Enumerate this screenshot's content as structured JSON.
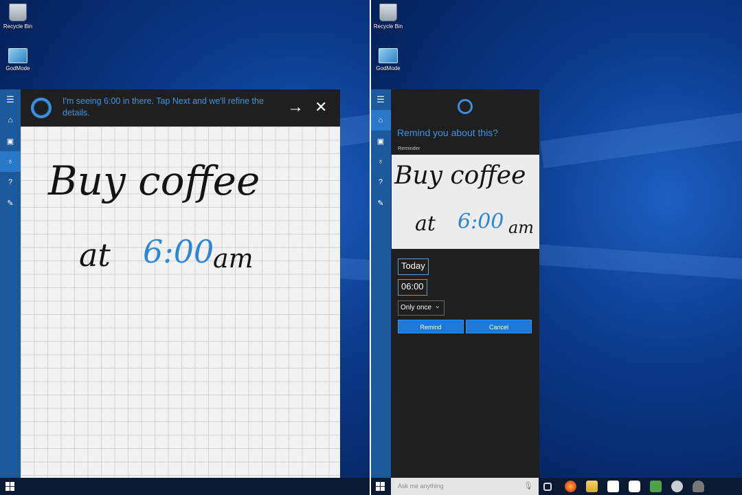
{
  "desktop": {
    "icons": [
      {
        "label": "Recycle Bin",
        "icon": "recycle-bin-icon"
      },
      {
        "label": "GodMode",
        "icon": "godmode-folder-icon"
      }
    ]
  },
  "cortana_rail": {
    "items": [
      {
        "icon": "menu-icon"
      },
      {
        "icon": "home-icon"
      },
      {
        "icon": "notebook-icon"
      },
      {
        "icon": "reminders-icon"
      },
      {
        "icon": "help-icon"
      },
      {
        "icon": "feedback-icon"
      }
    ]
  },
  "left_panel": {
    "message": "I'm seeing 6:00 in there. Tap Next and we'll refine the details.",
    "next_glyph": "→",
    "close_glyph": "✕",
    "ink": {
      "line1": "Buy coffee",
      "line2_prefix": "at",
      "line2_time": "6:00",
      "line2_suffix": "am"
    }
  },
  "right_panel": {
    "title": "Remind you about this?",
    "section_label": "Reminder",
    "ink": {
      "line1": "Buy coffee",
      "line2_prefix": "at",
      "line2_time": "6:00",
      "line2_suffix": "am"
    },
    "date_value": "Today",
    "time_value": "06:00",
    "repeat_value": "Only once",
    "remind_label": "Remind",
    "cancel_label": "Cancel"
  },
  "taskbar": {
    "search_placeholder": "Ask me anything",
    "mic_glyph": "🎙",
    "pinned_icons": [
      "task-view-icon",
      "firefox-icon",
      "file-explorer-icon",
      "store-icon",
      "app-icon",
      "notepad-icon",
      "bot-icon",
      "bug-icon"
    ]
  },
  "colors": {
    "accent": "#3a95e8",
    "button": "#1f78d6",
    "panel_dark": "#1f1f1f",
    "rail": "#1d5a9c"
  }
}
